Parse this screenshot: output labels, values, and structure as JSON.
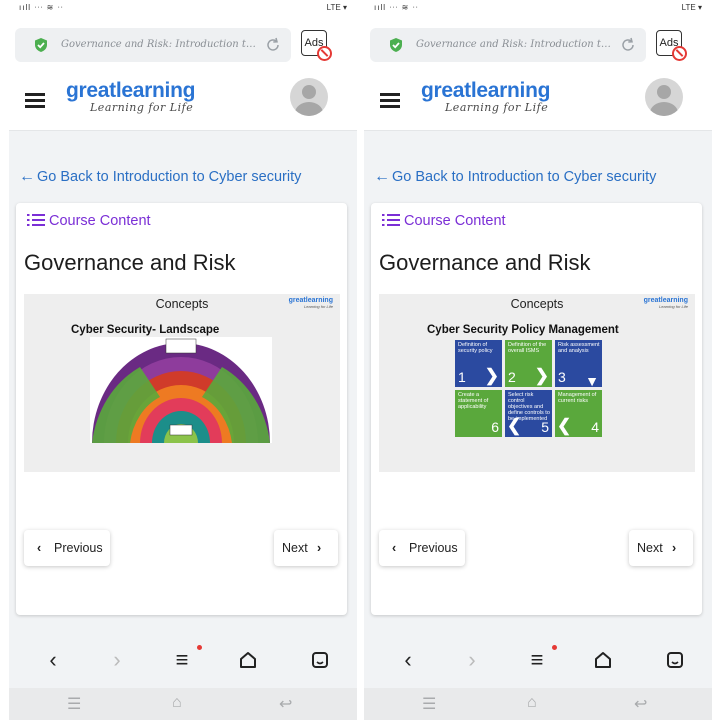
{
  "panels": [
    {
      "status": {
        "left": "ııll ᐧᐧᐧ ≋ ᐧᐧ",
        "right": "LTE ▾"
      },
      "url": {
        "text": "Governance and Risk: Introduction to ..."
      },
      "ads_label": "Ads",
      "logo": {
        "brand": "greatlearning",
        "tagline": "Learning for Life"
      },
      "back_link": "Go Back to Introduction to Cyber security",
      "course_content": "Course Content",
      "lesson_title": "Governance and Risk",
      "slide": {
        "heading": "Concepts",
        "logo": "greatlearning",
        "logo_tag": "Learning for Life",
        "subtitle": "Cyber Security- Landscape"
      },
      "prev_label": "Previous",
      "next_label": "Next"
    },
    {
      "status": {
        "left": "ııll ᐧᐧᐧ ≋ ᐧᐧ",
        "right": "LTE ▾"
      },
      "url": {
        "text": "Governance and Risk: Introduction to ..."
      },
      "ads_label": "Ads",
      "logo": {
        "brand": "greatlearning",
        "tagline": "Learning for Life"
      },
      "back_link": "Go Back to Introduction to Cyber security",
      "course_content": "Course Content",
      "lesson_title": "Governance and Risk",
      "slide": {
        "heading": "Concepts",
        "logo": "greatlearning",
        "logo_tag": "Learning for Life",
        "subtitle": "Cyber Security Policy Management",
        "tiles": [
          {
            "caption": "Definition of security policy",
            "number": "1",
            "color": "#2b4aa0"
          },
          {
            "caption": "Definition of the overall ISMS",
            "number": "2",
            "color": "#5aa83c"
          },
          {
            "caption": "Risk assessment and analysis",
            "number": "3",
            "color": "#2b4aa0"
          },
          {
            "caption": "Create a statement of applicability",
            "number": "6",
            "color": "#5aa83c"
          },
          {
            "caption": "Select risk control objectives and define controls to be implemented",
            "number": "5",
            "color": "#2b4aa0"
          },
          {
            "caption": "Management of current risks",
            "number": "4",
            "color": "#5aa83c"
          }
        ]
      },
      "prev_label": "Previous",
      "next_label": "Next"
    }
  ],
  "icons": {
    "secure": "shield-check-icon",
    "reload": "reload-icon",
    "menu": "hamburger-icon",
    "back": "arrow-left-icon",
    "list": "list-icon",
    "nav_back": "chevron-left-icon",
    "nav_forward": "chevron-right-icon",
    "nav_menu": "menu-icon",
    "nav_home": "home-icon",
    "nav_tabs": "tabs-icon"
  },
  "colors": {
    "brand_blue": "#2a74d4",
    "link_blue": "#2a6fc4",
    "course_purple": "#7b2fd6",
    "secure_green": "#4caf50",
    "alert_red": "#e53935"
  }
}
